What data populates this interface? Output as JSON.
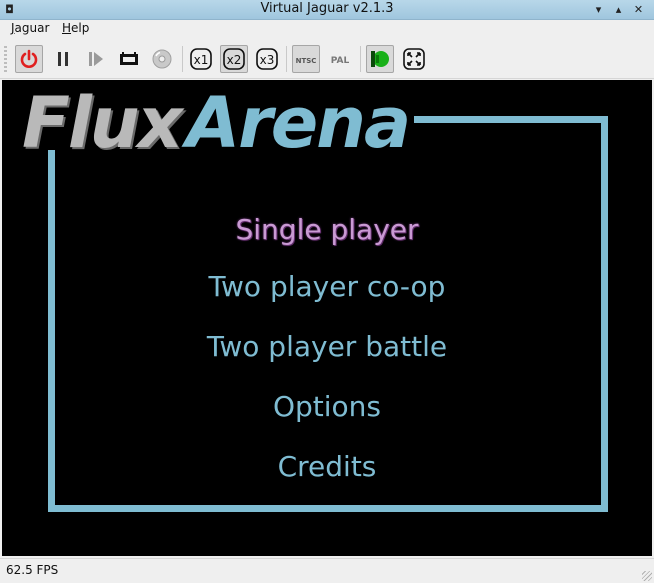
{
  "window": {
    "title": "Virtual Jaguar v2.1.3"
  },
  "menubar": {
    "items": [
      {
        "label": "Jaguar",
        "mnemonic": "J"
      },
      {
        "label": "Help",
        "mnemonic": "H"
      }
    ]
  },
  "toolbar": {
    "buttons": [
      {
        "icon": "power-icon",
        "pressed": true
      },
      {
        "icon": "pause-icon",
        "pressed": false
      },
      {
        "icon": "frame-advance-icon",
        "pressed": false
      },
      {
        "icon": "cartridge-icon",
        "pressed": false
      },
      {
        "icon": "cd-icon",
        "pressed": false
      },
      {
        "icon": "zoom-x1-icon",
        "label": "x1",
        "pressed": false
      },
      {
        "icon": "zoom-x2-icon",
        "label": "x2",
        "pressed": true
      },
      {
        "icon": "zoom-x3-icon",
        "label": "x3",
        "pressed": false
      },
      {
        "icon": "ntsc-icon",
        "label": "NTSC",
        "pressed": true
      },
      {
        "icon": "pal-icon",
        "label": "PAL",
        "pressed": false
      },
      {
        "icon": "blur-icon",
        "pressed": true
      },
      {
        "icon": "fullscreen-icon",
        "pressed": false
      }
    ]
  },
  "game": {
    "logo": {
      "word1": "Flux",
      "word2": "Arena"
    },
    "menu": [
      {
        "label": "Single player",
        "selected": true
      },
      {
        "label": "Two player co-op",
        "selected": false
      },
      {
        "label": "Two player battle",
        "selected": false
      },
      {
        "label": "Options",
        "selected": false
      },
      {
        "label": "Credits",
        "selected": false
      }
    ],
    "colors": {
      "accent": "#7fbcd2",
      "selected": "#c99ad3",
      "logo_gray": "#b9b9b9"
    }
  },
  "status": {
    "fps": "62.5 FPS"
  }
}
